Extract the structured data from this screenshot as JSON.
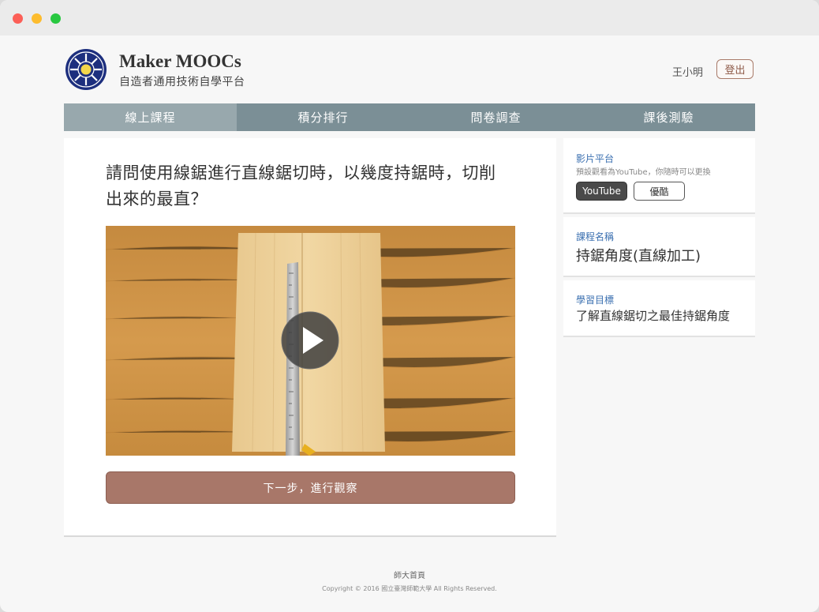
{
  "header": {
    "brand_title": "Maker MOOCs",
    "brand_subtitle": "自造者通用技術自學平台",
    "username": "王小明",
    "logout_label": "登出"
  },
  "nav": {
    "tabs": [
      {
        "label": "線上課程",
        "active": true
      },
      {
        "label": "積分排行",
        "active": false
      },
      {
        "label": "問卷調查",
        "active": false
      },
      {
        "label": "課後測驗",
        "active": false
      }
    ]
  },
  "main": {
    "question": "請問使用線鋸進行直線鋸切時，以幾度持鋸時，切削出來的最直？",
    "video_play_icon": "play-icon",
    "next_button_label": "下一步，進行觀察"
  },
  "sidebar": {
    "platform": {
      "label": "影片平台",
      "hint": "預設觀看為YouTube，你隨時可以更換",
      "options": [
        "YouTube",
        "優酷"
      ],
      "selected": "YouTube"
    },
    "course": {
      "label": "課程名稱",
      "value": "持鋸角度(直線加工)"
    },
    "goal": {
      "label": "學習目標",
      "value": "了解直線鋸切之最佳持鋸角度"
    }
  },
  "footer": {
    "link": "師大首頁",
    "copyright": "Copyright © 2016 國立臺灣師範大學 All Rights Reserved."
  },
  "colors": {
    "nav_bg": "#7b8f96",
    "nav_active": "#98a8ad",
    "accent_button": "#a87769",
    "label_blue": "#3a6fb0"
  }
}
